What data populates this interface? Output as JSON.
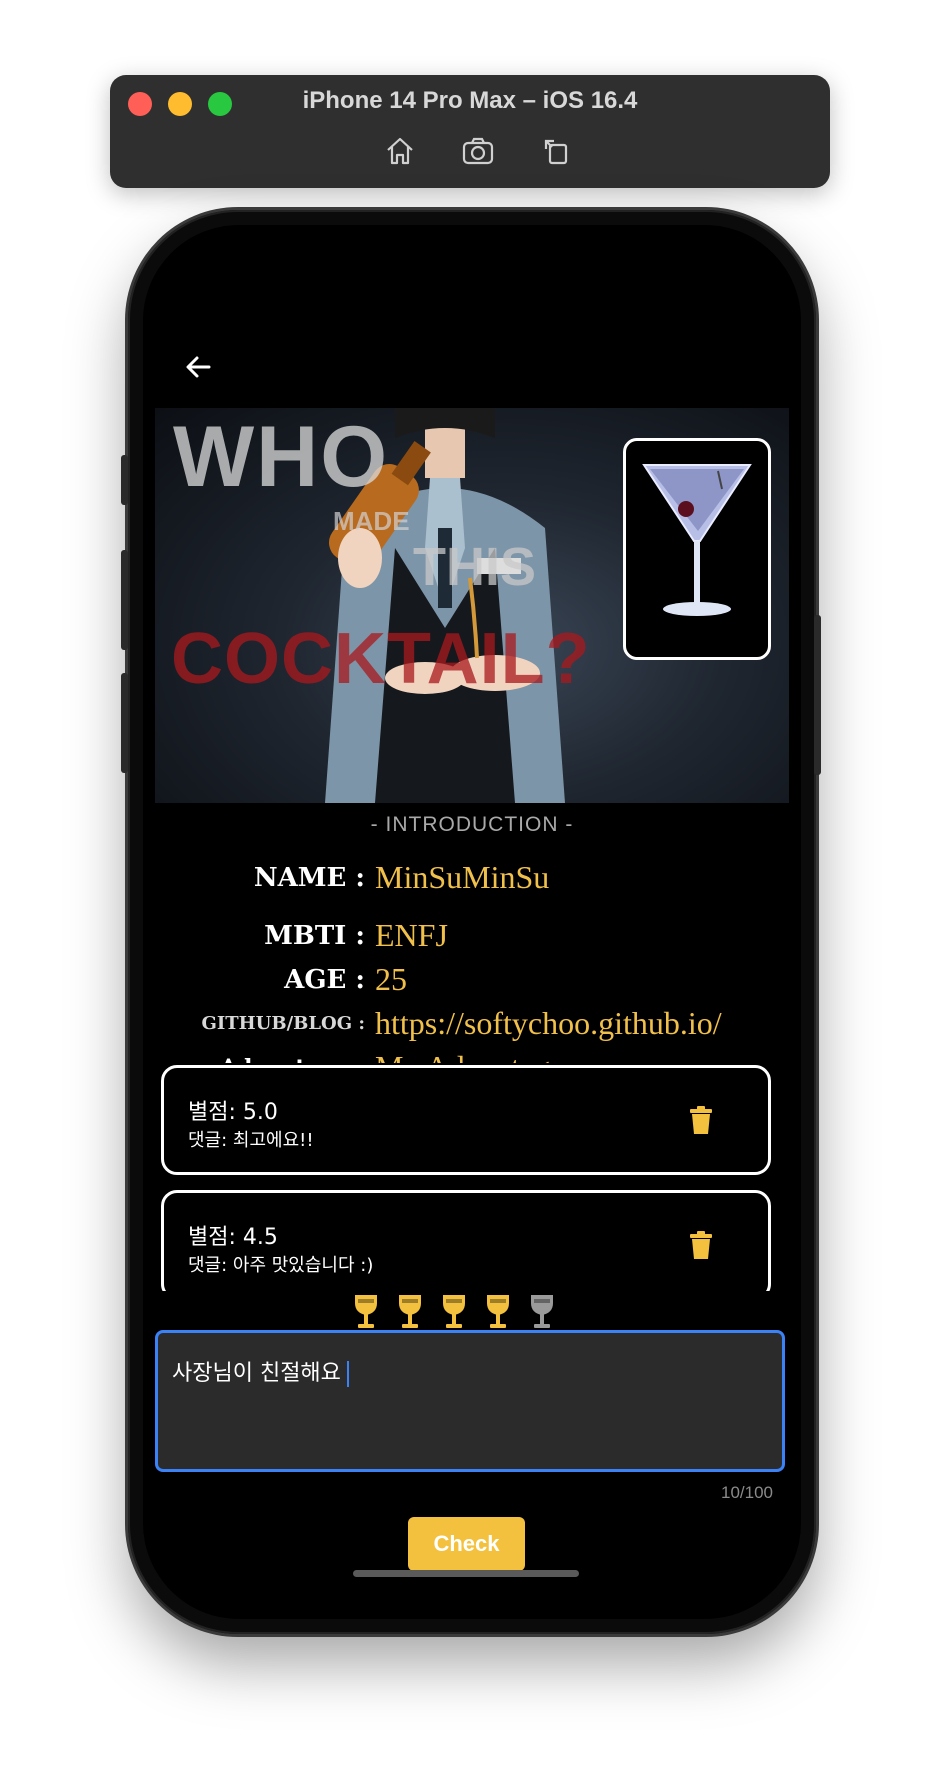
{
  "simulator": {
    "title": "iPhone 14 Pro Max – iOS 16.4",
    "toolbar_icons": [
      "home-icon",
      "screenshot-icon",
      "rotate-icon"
    ]
  },
  "hero": {
    "overlay_text": {
      "who": "WHO",
      "made": "MADE",
      "this": "THIS",
      "cocktail": "COCKTAIL?"
    },
    "glass_image": "martini-glass"
  },
  "introduction": {
    "heading": "- INTRODUCTION -",
    "rows": [
      {
        "label": "NAME :",
        "value": "MinSuMinSu"
      },
      {
        "label": "MBTI :",
        "value": "ENFJ"
      },
      {
        "label": "AGE :",
        "value": "25"
      },
      {
        "label": "GITHUB/BLOG :",
        "value": "https://softychoo.github.io/"
      },
      {
        "label": "Advantage :",
        "value": "My Advantage"
      }
    ]
  },
  "reviews": [
    {
      "score": "별점: 5.0",
      "comment": "댓글: 최고에요!!"
    },
    {
      "score": "별점: 4.5",
      "comment": "댓글: 아주 맛있습니다 :)"
    }
  ],
  "rating": {
    "value": 4,
    "max": 5
  },
  "comment_input": {
    "value": "사장님이 친절해요",
    "counter": "10/100"
  },
  "check_label": "Check",
  "colors": {
    "accent": "#f3c13e",
    "focus": "#3b82f6",
    "value_text": "#f0c04a"
  }
}
